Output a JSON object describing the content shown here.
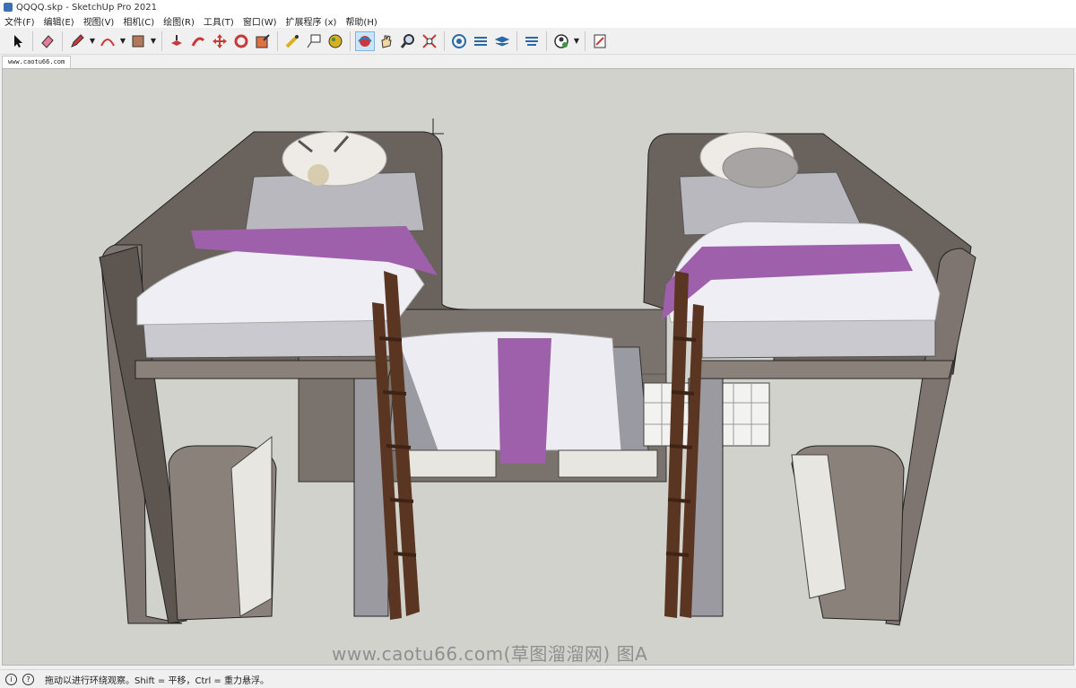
{
  "window": {
    "title": "QQQQ.skp - SketchUp Pro 2021"
  },
  "menu": [
    "文件(F)",
    "编辑(E)",
    "视图(V)",
    "相机(C)",
    "绘图(R)",
    "工具(T)",
    "窗口(W)",
    "扩展程序 (x)",
    "帮助(H)"
  ],
  "toolbar": {
    "tools": [
      "select-icon",
      "eraser-icon",
      "pencil-icon",
      "arc-icon",
      "paint-bucket-icon",
      "push-pull-icon",
      "follow-me-icon",
      "move-icon",
      "rotate-icon",
      "scale-icon",
      "tape-measure-icon",
      "text-icon",
      "paint-icon",
      "orbit-icon",
      "pan-icon",
      "zoom-icon",
      "zoom-extents-icon",
      "warehouse-icon",
      "extension-warehouse-icon",
      "layers-icon",
      "styles-icon",
      "user-icon",
      "sandbox-icon"
    ],
    "active_tool": "orbit-icon"
  },
  "tab": {
    "label": "www.caotu66.com"
  },
  "viewport": {
    "background": "#d2d2cd",
    "watermark": "www.caotu66.com(草图溜溜网) 图A"
  },
  "status": {
    "text": "拖动以进行环绕观察。Shift = 平移，Ctrl = 重力悬浮。"
  },
  "colors": {
    "wood_dark": "#5e5753",
    "wood_light": "#8a817b",
    "mattress": "#c9c9cf",
    "duvet": "#eeeef4",
    "purple": "#9e5fab",
    "ladder": "#5a3622"
  }
}
